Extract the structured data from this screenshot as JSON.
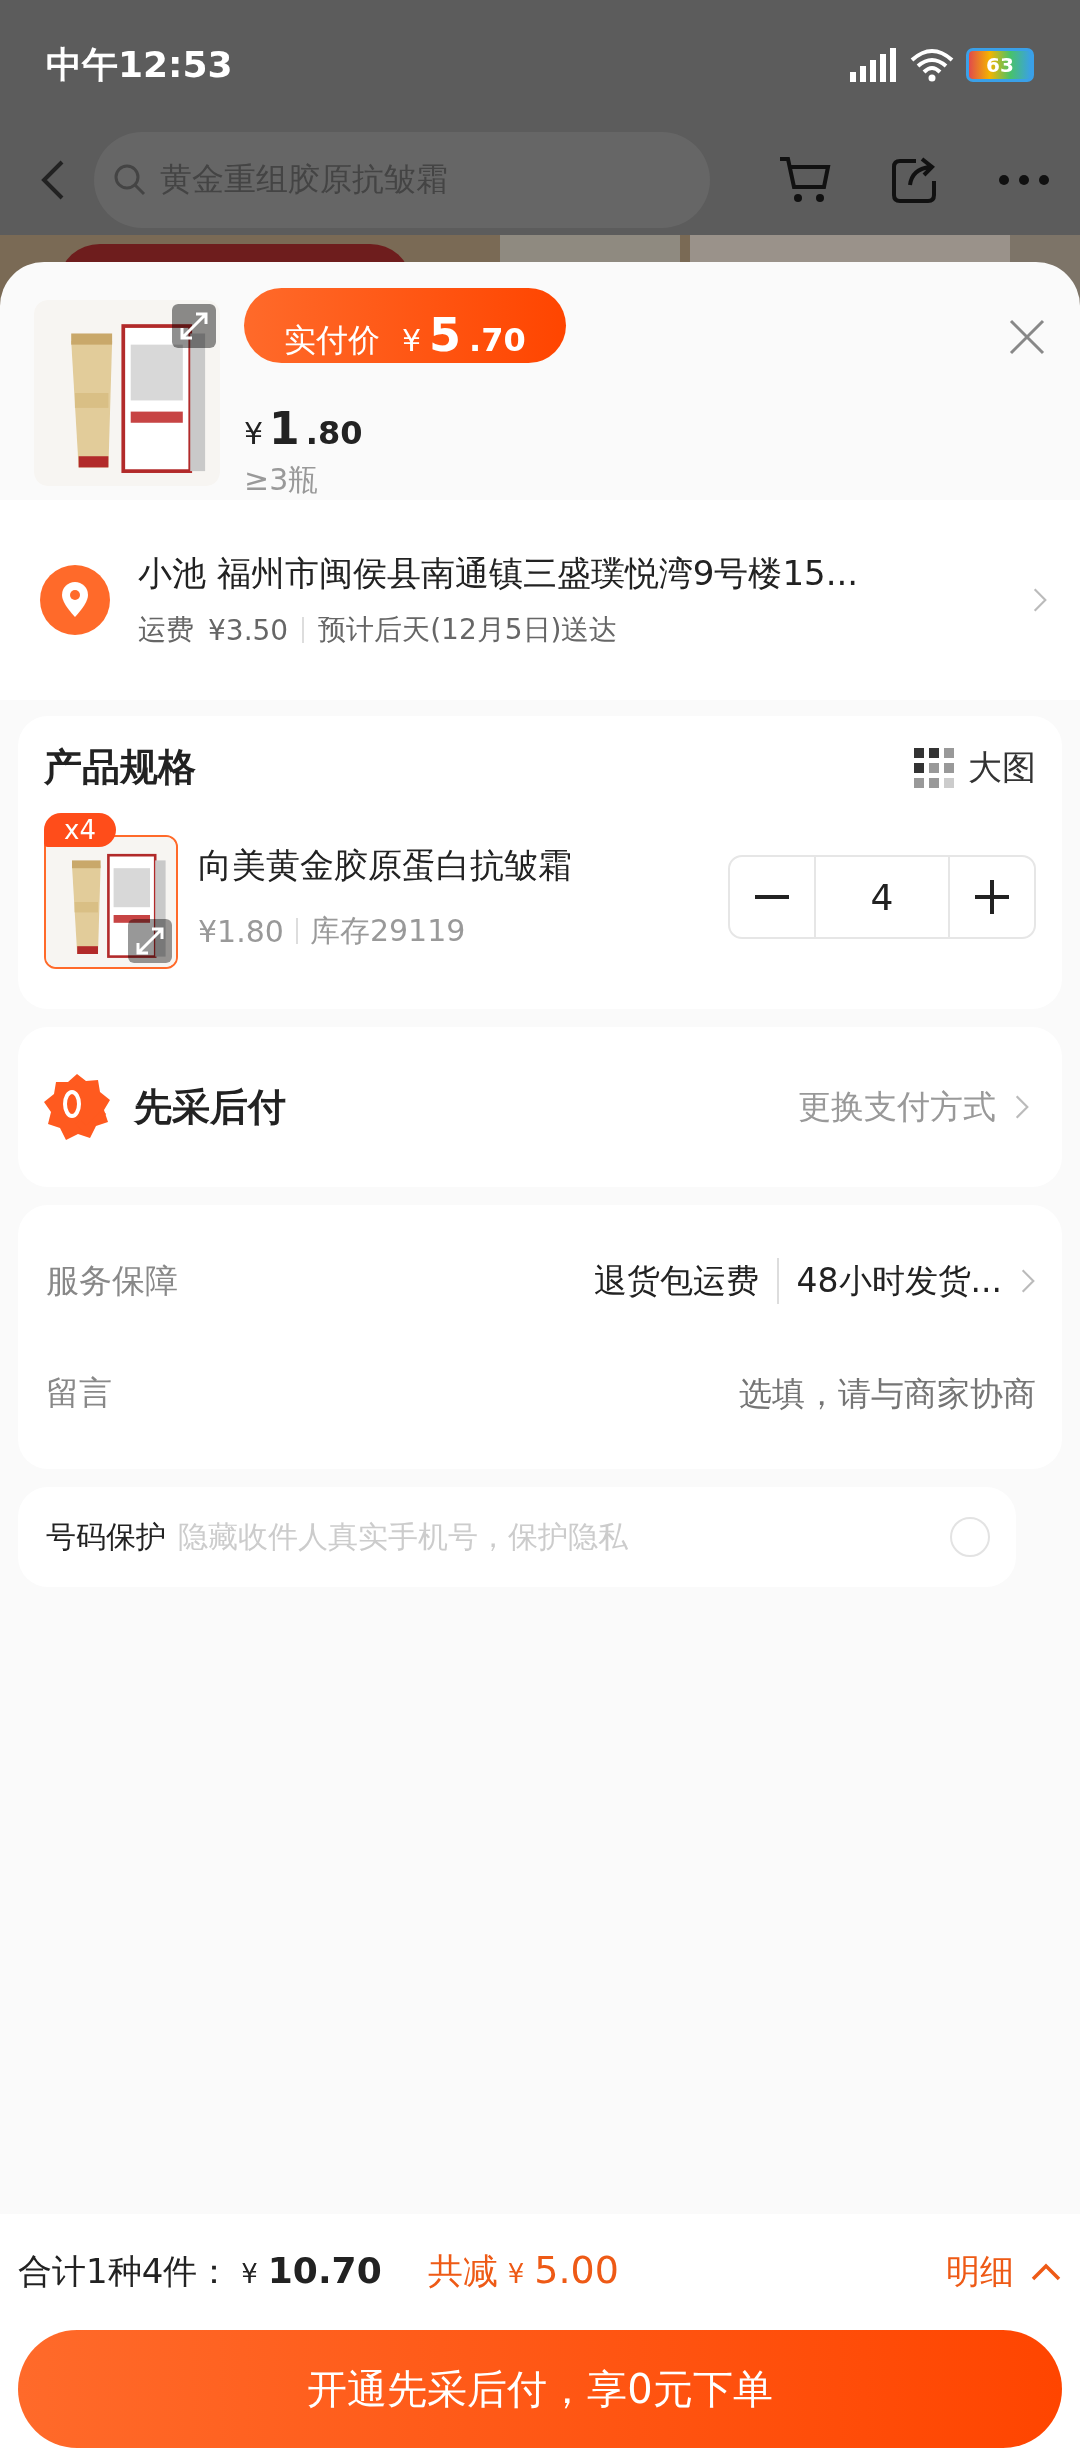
{
  "status_bar": {
    "time": "中午12:53",
    "battery": "63"
  },
  "nav": {
    "search_placeholder": "黄金重组胶原抗皱霜"
  },
  "sheet": {
    "price_tag": {
      "label": "实付价",
      "symbol": "¥",
      "integer": "5",
      "decimal": ".70"
    },
    "unit_price": {
      "symbol": "¥",
      "integer": "1",
      "decimal": ".80"
    },
    "min_qty": "≥3瓶"
  },
  "address": {
    "text": "小池 福州市闽侯县南通镇三盛璞悦湾9号楼15...",
    "shipping_label": "运费",
    "shipping_fee": "¥3.50",
    "eta": "预计后天(12月5日)送达"
  },
  "spec": {
    "title": "产品规格",
    "view_toggle": "大图",
    "items": [
      {
        "badge": "x4",
        "name": "向美黄金胶原蛋白抗皱霜",
        "price": "¥1.80",
        "stock": "库存29119",
        "quantity": "4"
      }
    ]
  },
  "payment": {
    "title": "先采后付",
    "action": "更换支付方式"
  },
  "services": [
    {
      "kind": "tags",
      "label": "服务保障",
      "values": [
        "退货包运费",
        "48小时发货..."
      ]
    },
    {
      "kind": "input",
      "label": "留言",
      "placeholder": "选填，请与商家协商"
    }
  ],
  "privacy": {
    "label": "号码保护",
    "hint": "隐藏收件人真实手机号，保护隐私",
    "checked": false
  },
  "footer": {
    "total_label": "合计1种4件：",
    "total_symbol": "¥",
    "total": "10.70",
    "discount_label": "共减",
    "discount_symbol": "¥",
    "discount": "5.00",
    "details": "明细",
    "submit": "开通先采后付，享0元下单"
  }
}
